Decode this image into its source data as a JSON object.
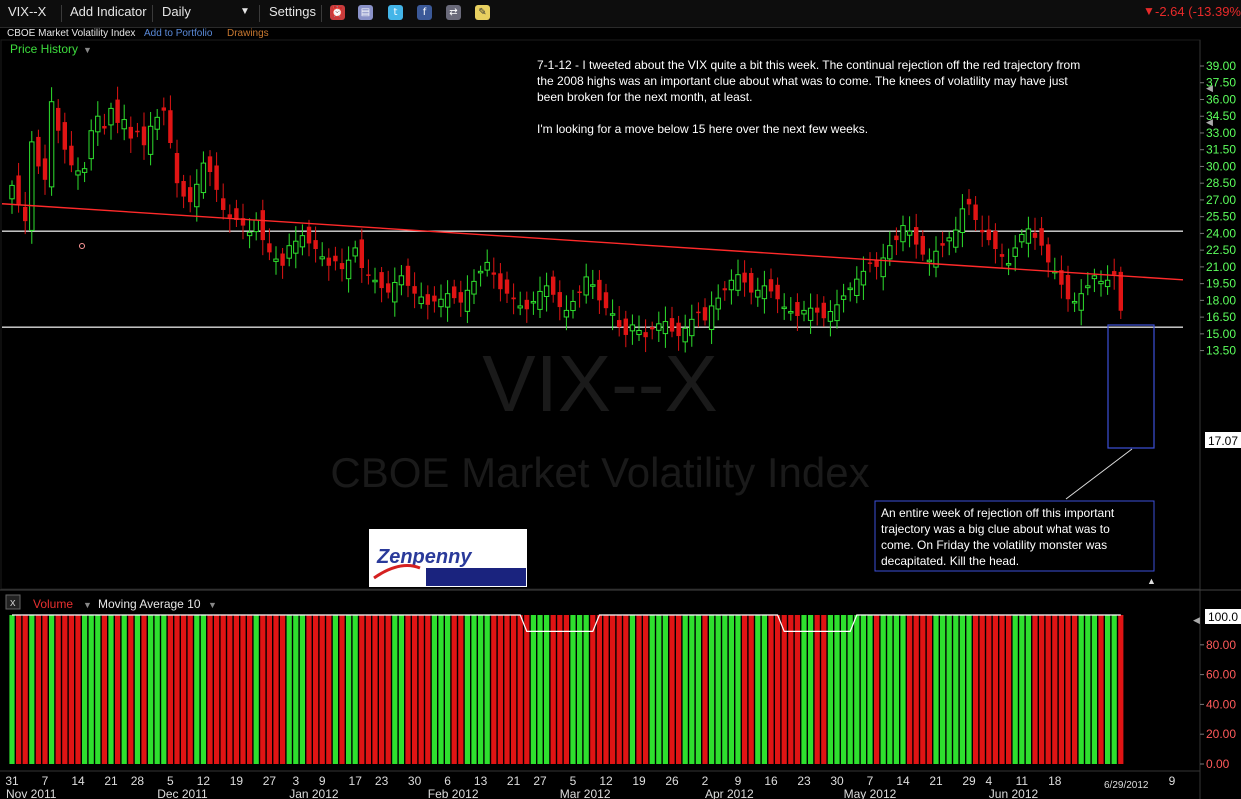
{
  "toolbar": {
    "symbol": "VIX--X",
    "add_indicator": "Add Indicator",
    "interval": "Daily",
    "settings": "Settings",
    "change": "-2.64 (-13.39%)"
  },
  "subheader": {
    "name": "CBOE Market Volatility Index",
    "add_portfolio": "Add to Portfolio",
    "drawings": "Drawings"
  },
  "price_panel": {
    "label": "Price History",
    "watermark_symbol": "VIX--X",
    "watermark_name": "CBOE Market Volatility Index",
    "last_price": "17.07",
    "note": [
      "7-1-12 - I tweeted about the VIX quite a bit this week. The continual rejection off the red trajectory from",
      "the 2008 highs was an important clue about what was to come. The knees of volatility may have just",
      "been broken for the next month, at least.",
      "",
      "I'm looking for a move below 15 here over the next few weeks."
    ],
    "callout": [
      "An entire week of rejection off this important",
      "trajectory was a big clue about what was to",
      "come. On Friday the volatility monster was",
      "decapitated. Kill the head."
    ],
    "logo_text": "Zenpenny"
  },
  "volume_panel": {
    "close_glyph": "x",
    "label": "Volume",
    "ma_label": "Moving Average 10",
    "last_value": "100.0"
  },
  "xaxis": {
    "date_stamp": "6/29/2012",
    "days": [
      {
        "label": "31",
        "i": 0
      },
      {
        "label": "7",
        "i": 5
      },
      {
        "label": "14",
        "i": 10
      },
      {
        "label": "21",
        "i": 15
      },
      {
        "label": "28",
        "i": 19
      },
      {
        "label": "5",
        "i": 24
      },
      {
        "label": "12",
        "i": 29
      },
      {
        "label": "19",
        "i": 34
      },
      {
        "label": "27",
        "i": 39
      },
      {
        "label": "3",
        "i": 43
      },
      {
        "label": "9",
        "i": 47
      },
      {
        "label": "17",
        "i": 52
      },
      {
        "label": "23",
        "i": 56
      },
      {
        "label": "30",
        "i": 61
      },
      {
        "label": "6",
        "i": 66
      },
      {
        "label": "13",
        "i": 71
      },
      {
        "label": "21",
        "i": 76
      },
      {
        "label": "27",
        "i": 80
      },
      {
        "label": "5",
        "i": 85
      },
      {
        "label": "12",
        "i": 90
      },
      {
        "label": "19",
        "i": 95
      },
      {
        "label": "26",
        "i": 100
      },
      {
        "label": "2",
        "i": 105
      },
      {
        "label": "9",
        "i": 110
      },
      {
        "label": "16",
        "i": 115
      },
      {
        "label": "23",
        "i": 120
      },
      {
        "label": "30",
        "i": 125
      },
      {
        "label": "7",
        "i": 130
      },
      {
        "label": "14",
        "i": 135
      },
      {
        "label": "21",
        "i": 140
      },
      {
        "label": "29",
        "i": 145
      },
      {
        "label": "4",
        "i": 148
      },
      {
        "label": "11",
        "i": 153
      },
      {
        "label": "18",
        "i": 158
      },
      {
        "label": "9",
        "i": 173
      }
    ],
    "months": [
      {
        "label": "Nov 2011",
        "i": -2
      },
      {
        "label": "Dec 2011",
        "i": 22
      },
      {
        "label": "Jan 2012",
        "i": 42
      },
      {
        "label": "Feb 2012",
        "i": 63
      },
      {
        "label": "Mar 2012",
        "i": 83
      },
      {
        "label": "Apr 2012",
        "i": 105
      },
      {
        "label": "May 2012",
        "i": 126
      },
      {
        "label": "Jun 2012",
        "i": 148
      }
    ]
  },
  "colors": {
    "up": "#2ee02e",
    "down": "#e01414",
    "trend": "#ff2a2a",
    "hline": "#dcdcdc",
    "axis_price": "#5cff5c",
    "axis_vol": "#ff5a5a",
    "text": "#ffffff",
    "box": "#3c50d8"
  },
  "chart_data": [
    {
      "type": "candlestick",
      "title": "VIX--X",
      "interval": "Daily",
      "x_start": "2011-10-28",
      "x_end": "2012-06-29",
      "yaxis_ticks": [
        13.5,
        15,
        16.5,
        18,
        19.5,
        21,
        22.5,
        24,
        25.5,
        27,
        28.5,
        30,
        31.5,
        33,
        34.5,
        36,
        37.5,
        39
      ],
      "ylim": [
        12.5,
        39.8
      ],
      "last_close": 17.07,
      "horizontal_lines": [
        24.2,
        15.6
      ],
      "trendline": {
        "from": {
          "date": "2011-10-28",
          "value": 26.6
        },
        "to": {
          "date": "2012-06-29",
          "value": 20.2
        }
      },
      "closes": [
        28.3,
        26.6,
        25.1,
        32.2,
        30.0,
        28.8,
        35.8,
        33.2,
        31.5,
        30.1,
        29.6,
        29.8,
        33.2,
        34.5,
        33.4,
        35.2,
        33.9,
        34.2,
        32.5,
        33.1,
        31.9,
        33.6,
        34.4,
        35.0,
        32.1,
        28.5,
        27.3,
        26.8,
        28.4,
        30.3,
        29.5,
        27.9,
        26.1,
        25.4,
        25.2,
        24.7,
        24.1,
        25.2,
        23.4,
        22.3,
        21.7,
        21.1,
        22.9,
        23.3,
        23.8,
        23.1,
        22.6,
        21.9,
        21.1,
        21.5,
        20.8,
        21.6,
        22.7,
        20.9,
        20.3,
        19.8,
        19.1,
        18.7,
        19.6,
        20.2,
        19.3,
        18.6,
        18.3,
        17.6,
        17.9,
        18.1,
        18.6,
        18.2,
        17.8,
        18.9,
        19.7,
        20.6,
        21.4,
        20.3,
        19.0,
        18.6,
        18.1,
        17.5,
        17.2,
        17.9,
        18.8,
        19.3,
        18.5,
        17.4,
        17.1,
        17.9,
        18.7,
        20.1,
        19.4,
        18.0,
        17.3,
        16.8,
        15.6,
        14.9,
        15.8,
        15.3,
        14.7,
        15.4,
        15.9,
        16.1,
        15.2,
        14.8,
        15.5,
        16.3,
        16.9,
        16.2,
        17.5,
        18.2,
        18.9,
        19.8,
        20.3,
        19.6,
        18.7,
        18.9,
        19.3,
        18.8,
        18.1,
        17.4,
        17.0,
        16.6,
        17.1,
        17.3,
        16.9,
        16.4,
        17.0,
        17.6,
        18.4,
        19.1,
        19.9,
        20.6,
        21.3,
        21.0,
        21.8,
        22.9,
        23.4,
        24.7,
        24.2,
        23.0,
        22.1,
        21.6,
        22.4,
        22.9,
        23.6,
        24.3,
        26.2,
        26.6,
        25.2,
        24.1,
        23.4,
        22.6,
        21.9,
        21.3,
        22.7,
        23.9,
        24.4,
        23.6,
        22.9,
        21.4,
        20.6,
        19.4,
        18.1,
        17.9,
        18.6,
        19.3,
        20.2,
        19.7,
        19.8,
        20.3,
        17.07
      ],
      "volume": {
        "panel_ylim": [
          0,
          100
        ],
        "yaxis_ticks": [
          0,
          20,
          40,
          60,
          80,
          100
        ],
        "moving_average": 10
      }
    }
  ]
}
